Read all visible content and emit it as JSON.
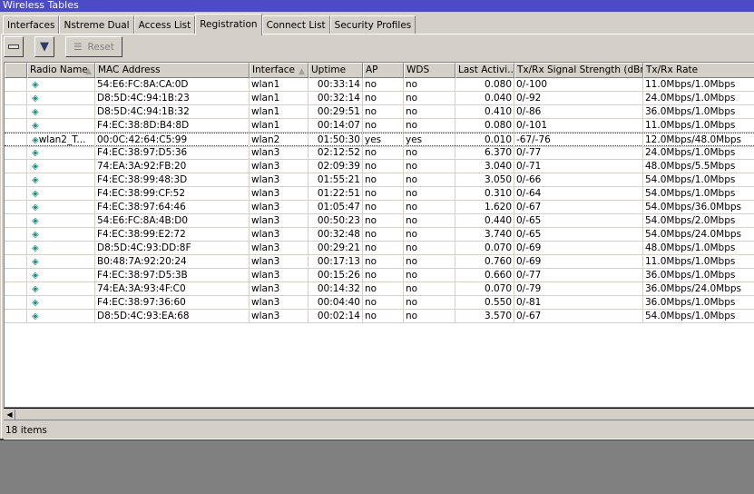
{
  "window": {
    "title": "Wireless Tables"
  },
  "tabs": [
    {
      "label": "Interfaces"
    },
    {
      "label": "Nstreme Dual"
    },
    {
      "label": "Access List"
    },
    {
      "label": "Registration",
      "active": true
    },
    {
      "label": "Connect List"
    },
    {
      "label": "Security Profiles"
    }
  ],
  "toolbar": {
    "reset_label": "Reset"
  },
  "columns": [
    {
      "label": "",
      "sort": false
    },
    {
      "label": "Radio Name",
      "sort": true
    },
    {
      "label": "MAC Address",
      "sort": false
    },
    {
      "label": "Interface",
      "sort": true
    },
    {
      "label": "Uptime",
      "sort": false
    },
    {
      "label": "AP",
      "sort": false
    },
    {
      "label": "WDS",
      "sort": false
    },
    {
      "label": "Last Activi...",
      "sort": false
    },
    {
      "label": "Tx/Rx Signal Strength (dBm)",
      "sort": false
    },
    {
      "label": "Tx/Rx Rate",
      "sort": false
    }
  ],
  "rows": [
    [
      "",
      "54:E6:FC:8A:CA:0D",
      "wlan1",
      "00:33:14",
      "no",
      "no",
      "0.080",
      "0/-100",
      "11.0Mbps/1.0Mbps"
    ],
    [
      "",
      "D8:5D:4C:94:1B:23",
      "wlan1",
      "00:32:14",
      "no",
      "no",
      "0.040",
      "0/-92",
      "24.0Mbps/1.0Mbps"
    ],
    [
      "",
      "D8:5D:4C:94:1B:32",
      "wlan1",
      "00:29:51",
      "no",
      "no",
      "0.410",
      "0/-86",
      "36.0Mbps/1.0Mbps"
    ],
    [
      "",
      "F4:EC:38:8D:B4:8D",
      "wlan1",
      "00:14:07",
      "no",
      "no",
      "0.080",
      "0/-101",
      "11.0Mbps/1.0Mbps"
    ],
    [
      "wlan2_T...",
      "00:0C:42:64:C5:99",
      "wlan2",
      "01:50:30",
      "yes",
      "yes",
      "0.010",
      "-67/-76",
      "12.0Mbps/48.0Mbps"
    ],
    [
      "",
      "F4:EC:38:97:D5:36",
      "wlan3",
      "02:12:52",
      "no",
      "no",
      "6.370",
      "0/-77",
      "24.0Mbps/1.0Mbps"
    ],
    [
      "",
      "74:EA:3A:92:FB:20",
      "wlan3",
      "02:09:39",
      "no",
      "no",
      "3.040",
      "0/-71",
      "48.0Mbps/5.5Mbps"
    ],
    [
      "",
      "F4:EC:38:99:48:3D",
      "wlan3",
      "01:55:21",
      "no",
      "no",
      "3.050",
      "0/-66",
      "54.0Mbps/1.0Mbps"
    ],
    [
      "",
      "F4:EC:38:99:CF:52",
      "wlan3",
      "01:22:51",
      "no",
      "no",
      "0.310",
      "0/-64",
      "54.0Mbps/1.0Mbps"
    ],
    [
      "",
      "F4:EC:38:97:64:46",
      "wlan3",
      "01:05:47",
      "no",
      "no",
      "1.620",
      "0/-67",
      "54.0Mbps/36.0Mbps"
    ],
    [
      "",
      "54:E6:FC:8A:4B:D0",
      "wlan3",
      "00:50:23",
      "no",
      "no",
      "0.440",
      "0/-65",
      "54.0Mbps/2.0Mbps"
    ],
    [
      "",
      "F4:EC:38:99:E2:72",
      "wlan3",
      "00:32:48",
      "no",
      "no",
      "3.740",
      "0/-65",
      "54.0Mbps/24.0Mbps"
    ],
    [
      "",
      "D8:5D:4C:93:DD:8F",
      "wlan3",
      "00:29:21",
      "no",
      "no",
      "0.070",
      "0/-69",
      "48.0Mbps/1.0Mbps"
    ],
    [
      "",
      "B0:48:7A:92:20:24",
      "wlan3",
      "00:17:13",
      "no",
      "no",
      "0.760",
      "0/-69",
      "11.0Mbps/1.0Mbps"
    ],
    [
      "",
      "F4:EC:38:97:D5:3B",
      "wlan3",
      "00:15:26",
      "no",
      "no",
      "0.660",
      "0/-77",
      "36.0Mbps/1.0Mbps"
    ],
    [
      "",
      "74:EA:3A:93:4F:C0",
      "wlan3",
      "00:14:32",
      "no",
      "no",
      "0.070",
      "0/-79",
      "36.0Mbps/24.0Mbps"
    ],
    [
      "",
      "F4:EC:38:97:36:60",
      "wlan3",
      "00:04:40",
      "no",
      "no",
      "0.550",
      "0/-81",
      "36.0Mbps/1.0Mbps"
    ],
    [
      "",
      "D8:5D:4C:93:EA:68",
      "wlan3",
      "00:02:14",
      "no",
      "no",
      "3.570",
      "0/-67",
      "54.0Mbps/1.0Mbps"
    ]
  ],
  "selected_row": 4,
  "status": {
    "items": "18 items"
  },
  "colors": {
    "titlebar": "#4b4bc8",
    "icon": "#1a8a7a"
  }
}
